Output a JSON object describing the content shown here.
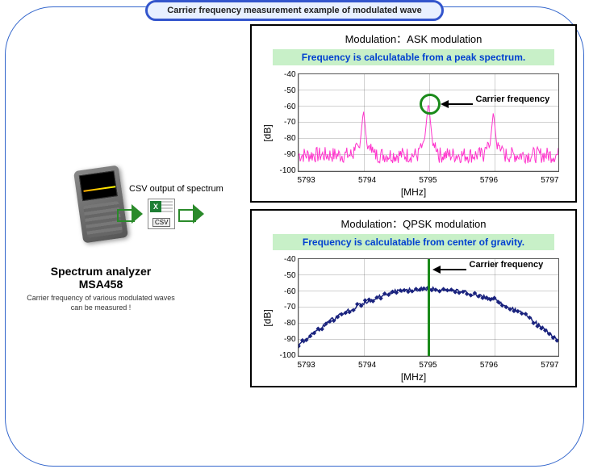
{
  "title": "Carrier frequency measurement example of modulated wave",
  "device": {
    "name": "Spectrum analyzer",
    "model": "MSA458",
    "caption": "Carrier frequency of various modulated waves can be measured !"
  },
  "csv_caption": "CSV output of spectrum",
  "csv_icon": {
    "xl": "X",
    "tag": "CSV"
  },
  "chart_data": [
    {
      "type": "line",
      "title": "Modulation：ASK modulation",
      "note": "Frequency is calculatable from a peak spectrum.",
      "xlabel": "[MHz]",
      "ylabel": "[dB]",
      "xlim": [
        5793,
        5797
      ],
      "ylim": [
        -100,
        -40
      ],
      "xticks": [
        "5793",
        "5794",
        "5795",
        "5796",
        "5797"
      ],
      "yticks": [
        "-40",
        "-50",
        "-60",
        "-70",
        "-80",
        "-90",
        "-100"
      ],
      "carrier_label": "Carrier frequency",
      "carrier_x": 5795,
      "peaks": [
        {
          "x": 5794.0,
          "y": -62
        },
        {
          "x": 5795.0,
          "y": -57
        },
        {
          "x": 5796.0,
          "y": -63
        }
      ],
      "noise_floor": -90,
      "color": "#ff33cc"
    },
    {
      "type": "line",
      "title": "Modulation：QPSK modulation",
      "note": "Frequency is calculatable from center of gravity.",
      "xlabel": "[MHz]",
      "ylabel": "[dB]",
      "xlim": [
        5793,
        5797
      ],
      "ylim": [
        -100,
        -40
      ],
      "xticks": [
        "5793",
        "5794",
        "5795",
        "5796",
        "5797"
      ],
      "yticks": [
        "-40",
        "-50",
        "-60",
        "-70",
        "-80",
        "-90",
        "-100"
      ],
      "carrier_label": "Carrier frequency",
      "carrier_x": 5795,
      "series": [
        {
          "x": 5793.0,
          "y": -93
        },
        {
          "x": 5793.5,
          "y": -78
        },
        {
          "x": 5794.0,
          "y": -67
        },
        {
          "x": 5794.5,
          "y": -60
        },
        {
          "x": 5795.0,
          "y": -58
        },
        {
          "x": 5795.5,
          "y": -60
        },
        {
          "x": 5796.0,
          "y": -65
        },
        {
          "x": 5796.5,
          "y": -75
        },
        {
          "x": 5797.0,
          "y": -90
        }
      ],
      "color": "#1a237e"
    }
  ]
}
